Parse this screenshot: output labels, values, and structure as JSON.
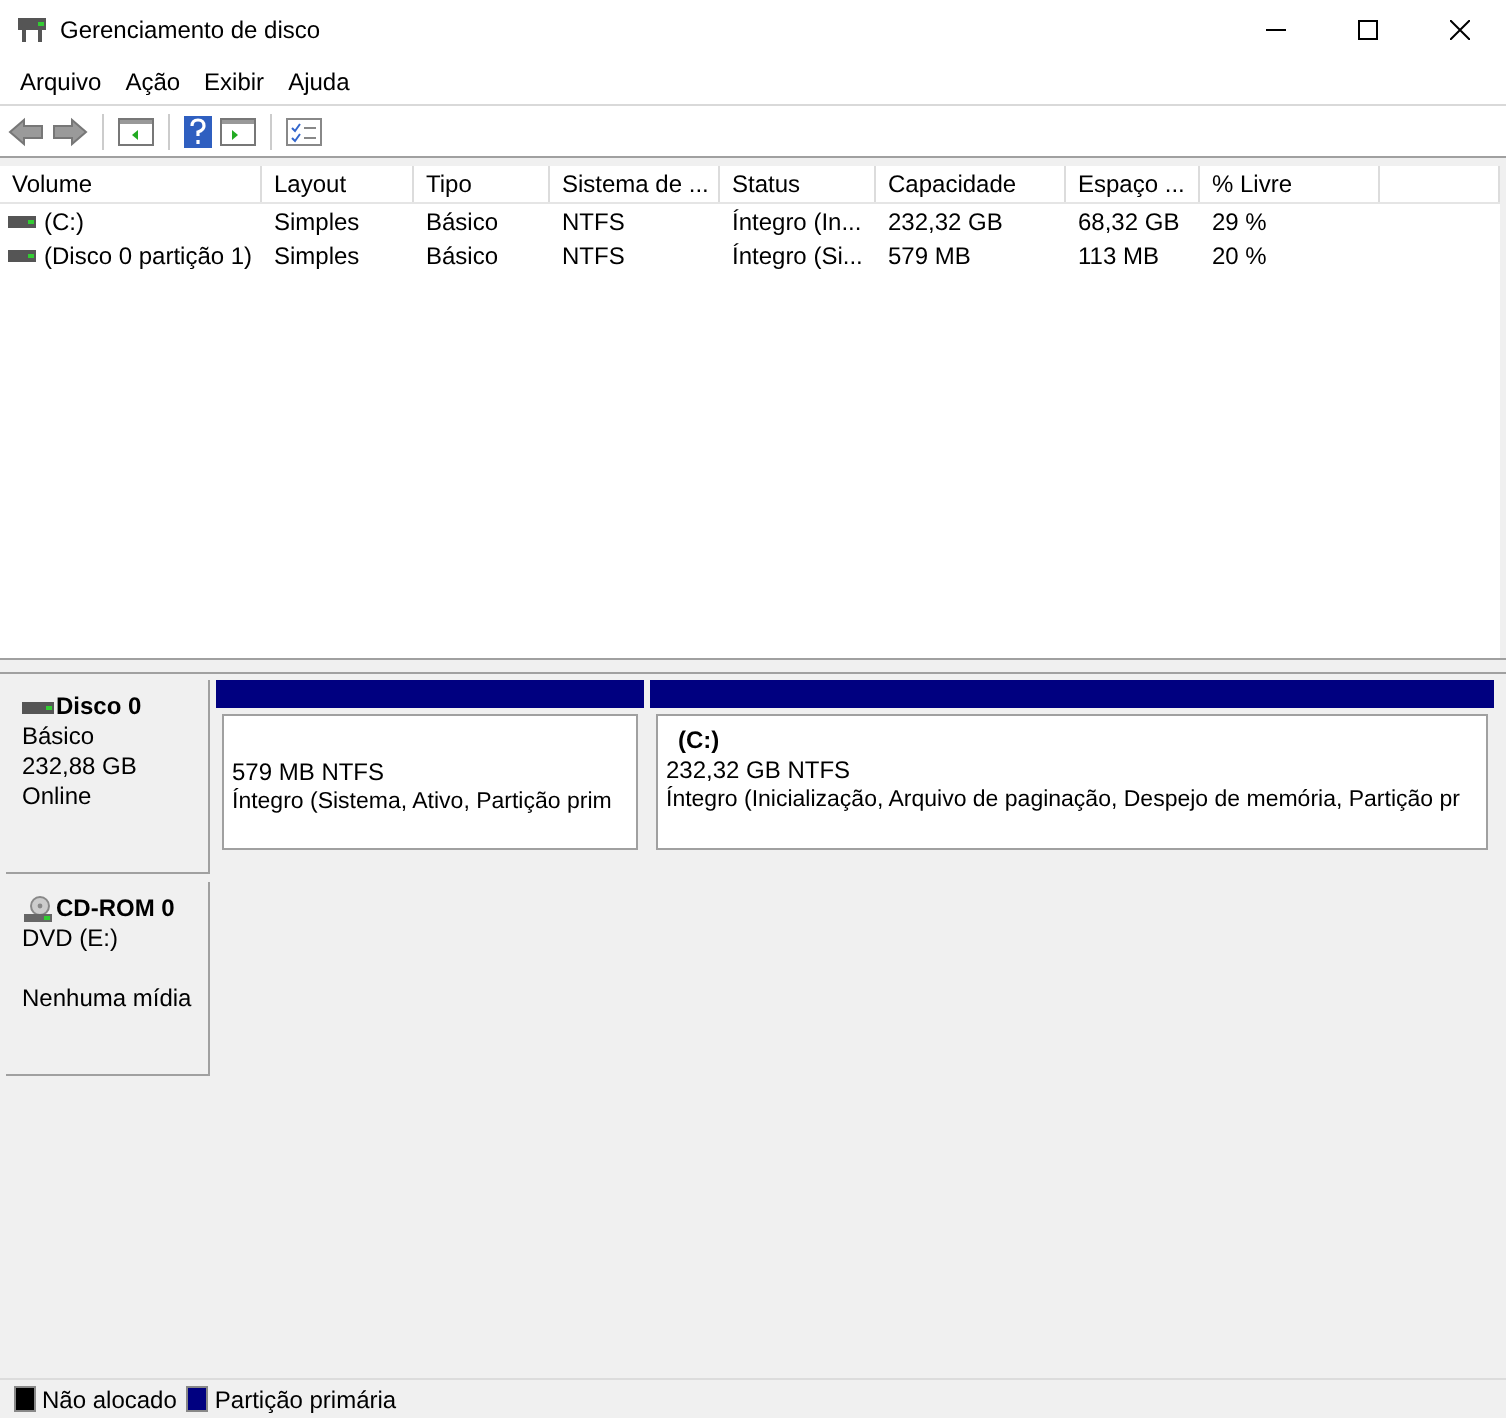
{
  "window": {
    "title": "Gerenciamento de disco"
  },
  "menu": [
    "Arquivo",
    "Ação",
    "Exibir",
    "Ajuda"
  ],
  "table": {
    "columns": [
      "Volume",
      "Layout",
      "Tipo",
      "Sistema de ...",
      "Status",
      "Capacidade",
      "Espaço ...",
      "% Livre"
    ],
    "rows": [
      [
        "(C:)",
        "Simples",
        "Básico",
        "NTFS",
        "Íntegro (In...",
        "232,32 GB",
        "68,32 GB",
        "29 %"
      ],
      [
        "(Disco 0 partição 1)",
        "Simples",
        "Básico",
        "NTFS",
        "Íntegro (Si...",
        "579 MB",
        "113 MB",
        "20 %"
      ]
    ]
  },
  "disks": [
    {
      "kind": "disk",
      "name": "Disco 0",
      "lines": [
        "Básico",
        "232,88 GB",
        "Online"
      ],
      "partitions": [
        {
          "kind": "primary",
          "size": "579 MB NTFS",
          "status": "Íntegro (Sistema, Ativo, Partição prim"
        },
        {
          "kind": "primary",
          "label": "(C:)",
          "size": "232,32 GB NTFS",
          "status": "Íntegro (Inicialização, Arquivo de paginação, Despejo de memória, Partição pr"
        }
      ]
    },
    {
      "kind": "cdrom",
      "name": "CD-ROM 0",
      "lines": [
        "DVD (E:)"
      ],
      "media": "Nenhuma mídia"
    }
  ],
  "legend": [
    {
      "label": "Não alocado",
      "color": "#000000"
    },
    {
      "label": "Partição primária",
      "color": "#000080"
    }
  ]
}
